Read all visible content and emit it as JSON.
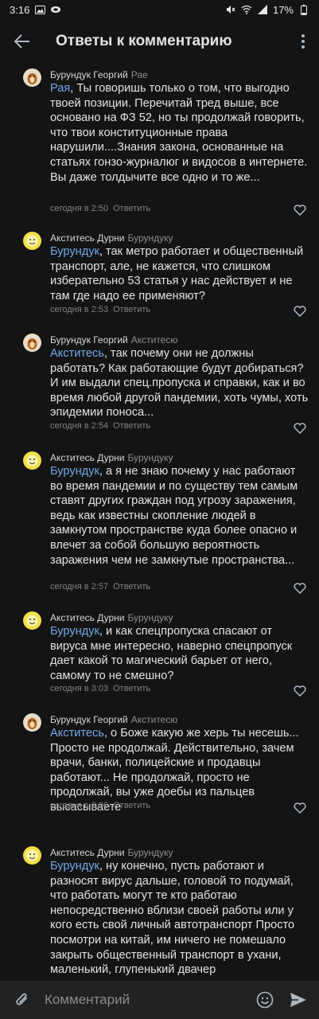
{
  "status_bar": {
    "time": "3:16",
    "battery": "17%",
    "icons": [
      "gallery-icon",
      "link-icon",
      "mute-icon",
      "wifi-icon",
      "signal-icon",
      "battery-icon"
    ]
  },
  "header": {
    "title": "Ответы к комментарию",
    "back_icon": "arrow-left-icon",
    "more_icon": "more-vertical-icon"
  },
  "comments": [
    {
      "author": "Бурундук Георгий",
      "reply_to": "Рае",
      "avatar": "chipmunk-avatar",
      "mention": "Рая",
      "text": ", Ты говоришь только о том, что выгодно твоей позиции. Перечитай тред выше, все основано на ФЗ 52, но ты продолжай говорить, что твои конституционные права нарушили....Знания закона, основанные на статьях гонзо-журналюг и видосов в интернете. Вы даже толдычите все одно и то же...",
      "time": "сегодня в 2:50",
      "reply_label": "Ответить"
    },
    {
      "author": "Акститесь Дурни",
      "reply_to": "Бурундуку",
      "avatar": "yellow-avatar",
      "mention": "Бурундук",
      "text": ", так метро работает и общественный транспорт, але, не кажется, что  слишком изберательно 53 статья у нас действует и не там где надо ее применяют?",
      "time": "сегодня в 2:53",
      "reply_label": "Ответить"
    },
    {
      "author": "Бурундук Георгий",
      "reply_to": "Акститесю",
      "avatar": "chipmunk-avatar",
      "mention": "Акститесь",
      "text": ", так почему они не должны работать? Как работающие будут добираться? И им выдали спец.пропуска и справки, как и во время любой другой пандемии, хоть чумы, хоть эпидемии поноса...",
      "time": "сегодня в 2:54",
      "reply_label": "Ответить"
    },
    {
      "author": "Акститесь Дурни",
      "reply_to": "Бурундуку",
      "avatar": "yellow-avatar",
      "mention": "Бурундук",
      "text": ", а я не знаю почему у нас работают во время пандемии и по существу тем самым ставят других граждан под угрозу заражения, ведь как известны скопление людей в замкнутом пространстве куда более опасно и влечет за собой большую вероятность заражения чем не замкнутые пространства...",
      "time": "сегодня в 2:57",
      "reply_label": "Ответить"
    },
    {
      "author": "Акститесь Дурни",
      "reply_to": "Бурундуку",
      "avatar": "yellow-avatar",
      "mention": "Бурундук",
      "text": ", и как спецпропуска спасают от вируса мне интересно, наверно спецпропуск дает какой то магический барьет от него, самому то не смешно?",
      "time": "сегодня в 3:03",
      "reply_label": "Ответить"
    },
    {
      "author": "Бурундук Георгий",
      "reply_to": "Акститесю",
      "avatar": "chipmunk-avatar",
      "mention": "Акститесь",
      "text": ", о Боже какую же херь ты несешь... Просто не продолжай. Действительно, зачем врачи, банки,  полицейские и продавцы работают... Не продолжай, просто не продолжай, вы уже доебы из пальцев высасываете",
      "time": "сегодня в 3:06",
      "reply_label": "Ответить"
    },
    {
      "author": "Акститесь Дурни",
      "reply_to": "Бурундуку",
      "avatar": "yellow-avatar",
      "mention": "Бурундук",
      "text": ", ну конечно, пусть работают и разносят вирус дальше, головой то подумай, что работать могут те кто работаю непосредственно вблизи своей работы или у кого есть свой личный автотранспорт Просто посмотри на китай, им ничего не помешало закрыть общественный транспорт в ухани, маленький, глупенький двачер",
      "time": "",
      "reply_label": ""
    }
  ],
  "composer": {
    "placeholder": "Комментарий",
    "attach_icon": "paperclip-icon",
    "emoji_icon": "smile-icon",
    "send_icon": "send-icon"
  }
}
